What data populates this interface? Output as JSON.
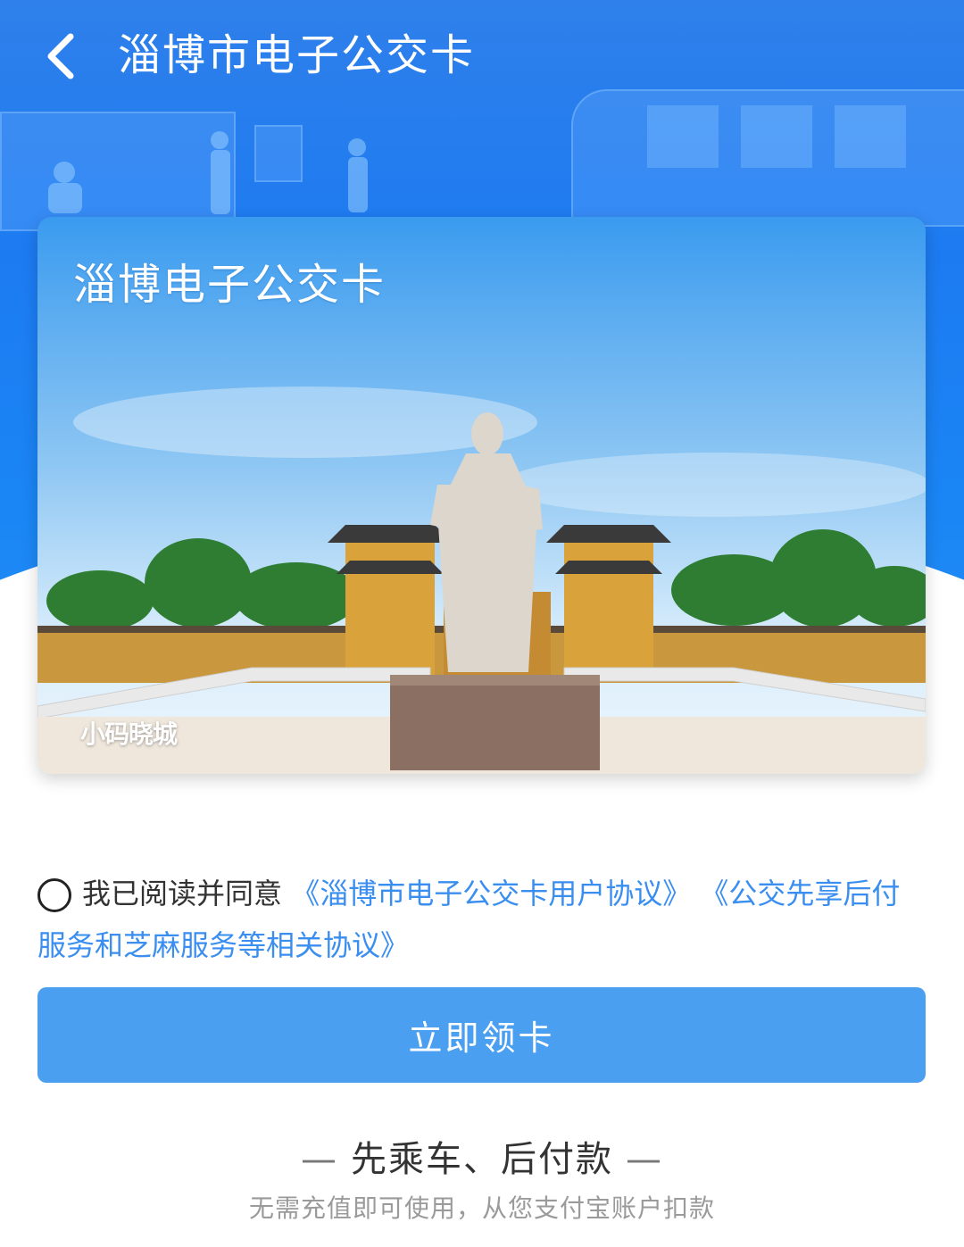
{
  "header": {
    "title": "淄博市电子公交卡",
    "back_icon": "chevron-left-icon"
  },
  "card": {
    "title": "淄博电子公交卡",
    "watermark": "小码晓城"
  },
  "agreement": {
    "prefix": "我已阅读并同意",
    "link1": "《淄博市电子公交卡用户协议》",
    "link2": "《公交先享后付服务和芝麻服务等相关协议》",
    "checked": false
  },
  "actions": {
    "primary_label": "立即领卡"
  },
  "footer": {
    "slogan": "先乘车、后付款",
    "dash": "—",
    "subtext": "无需充值即可使用，从您支付宝账户扣款"
  },
  "colors": {
    "header_blue": "#1d7bf2",
    "button_blue": "#4a9ff0",
    "link_blue": "#3a8ef0"
  }
}
